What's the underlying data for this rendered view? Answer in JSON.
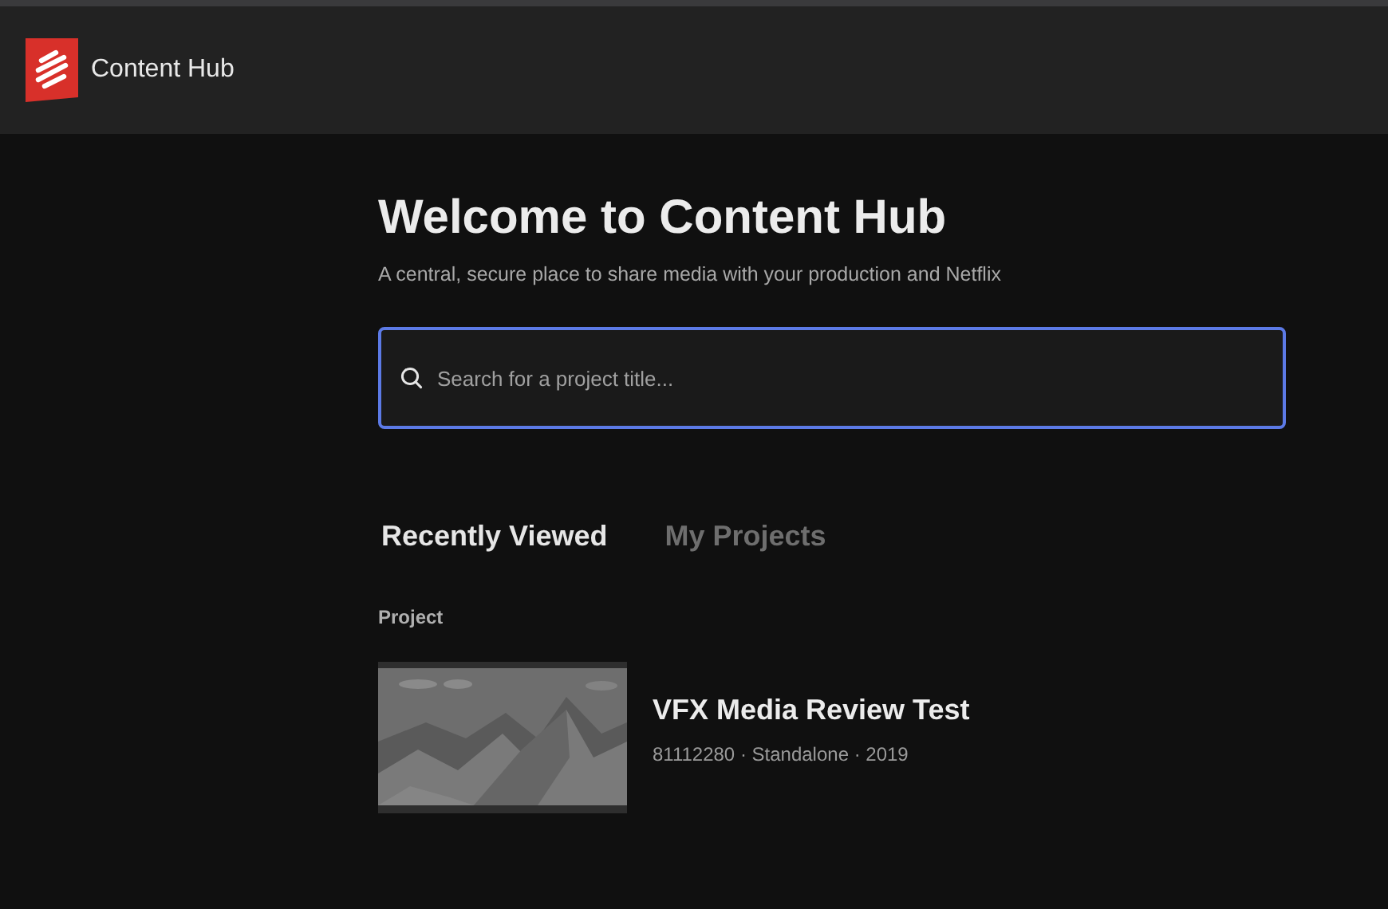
{
  "header": {
    "app_name": "Content Hub"
  },
  "welcome": {
    "title": "Welcome to Content Hub",
    "subtitle": "A central, secure place to share media with your production and Netflix"
  },
  "search": {
    "placeholder": "Search for a project title...",
    "focused": true
  },
  "tabs": [
    {
      "label": "Recently Viewed",
      "selected": true
    },
    {
      "label": "My Projects",
      "selected": false
    }
  ],
  "list": {
    "column_label": "Project",
    "items": [
      {
        "kind": "picture",
        "title": "VFX Media Review Test",
        "meta": "81112280 · Standalone · 2019"
      }
    ]
  }
}
